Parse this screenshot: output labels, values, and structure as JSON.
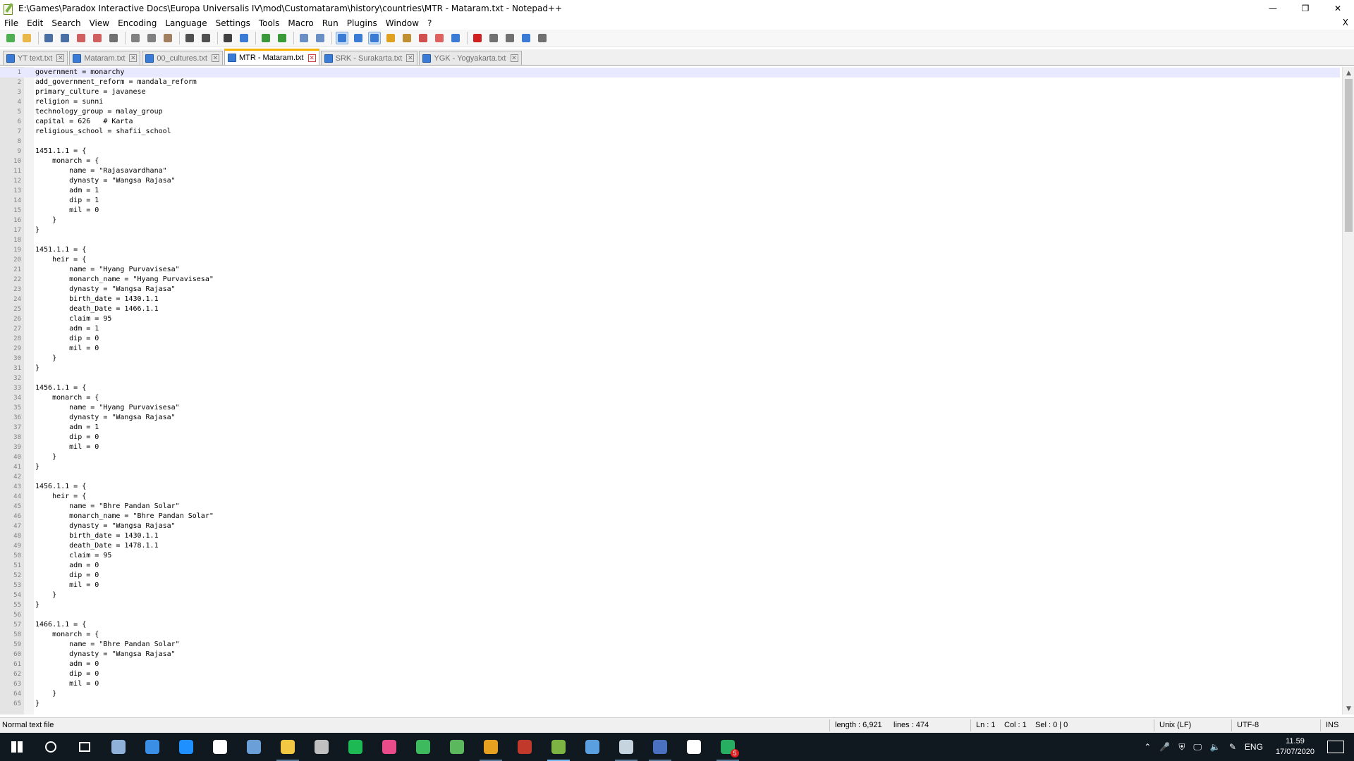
{
  "window": {
    "title": "E:\\Games\\Paradox Interactive Docs\\Europa Universalis IV\\mod\\Customataram\\history\\countries\\MTR - Mataram.txt - Notepad++",
    "controls": [
      "—",
      "❐",
      "✕"
    ]
  },
  "menu": {
    "items": [
      "File",
      "Edit",
      "Search",
      "View",
      "Encoding",
      "Language",
      "Settings",
      "Tools",
      "Macro",
      "Run",
      "Plugins",
      "Window",
      "?"
    ],
    "close_label": "X"
  },
  "toolbar": {
    "buttons": [
      {
        "name": "new-file-icon",
        "color": "#4caf50"
      },
      {
        "name": "open-file-icon",
        "color": "#e8b84a"
      },
      {
        "name": "save-icon",
        "color": "#4a6fa5"
      },
      {
        "name": "save-all-icon",
        "color": "#4a6fa5"
      },
      {
        "name": "close-icon",
        "color": "#d06060"
      },
      {
        "name": "close-all-icon",
        "color": "#d06060"
      },
      {
        "name": "print-icon",
        "color": "#707070"
      },
      {
        "name": "cut-icon",
        "color": "#808080"
      },
      {
        "name": "copy-icon",
        "color": "#808080"
      },
      {
        "name": "paste-icon",
        "color": "#a08060"
      },
      {
        "name": "undo-icon",
        "color": "#505050"
      },
      {
        "name": "redo-icon",
        "color": "#505050"
      },
      {
        "name": "find-icon",
        "color": "#404040"
      },
      {
        "name": "replace-icon",
        "color": "#3a7bd5"
      },
      {
        "name": "zoom-in-icon",
        "color": "#3a9a3a"
      },
      {
        "name": "zoom-out-icon",
        "color": "#3a9a3a"
      },
      {
        "name": "sync-v-scroll-icon",
        "color": "#6a8fc5"
      },
      {
        "name": "sync-h-scroll-icon",
        "color": "#6a8fc5"
      },
      {
        "name": "word-wrap-icon",
        "color": "#3a7bd5"
      },
      {
        "name": "show-all-chars-icon",
        "color": "#3a7bd5"
      },
      {
        "name": "indent-guide-icon",
        "color": "#3a7bd5"
      },
      {
        "name": "doc-map-icon",
        "color": "#e0a020"
      },
      {
        "name": "function-list-icon",
        "color": "#c09030"
      },
      {
        "name": "folder-workspace-icon",
        "color": "#d05050"
      },
      {
        "name": "doc-switcher-icon",
        "color": "#e06060"
      },
      {
        "name": "monitoring-icon",
        "color": "#3a7bd5"
      },
      {
        "name": "record-macro-icon",
        "color": "#d02020"
      },
      {
        "name": "stop-macro-icon",
        "color": "#707070"
      },
      {
        "name": "play-macro-icon",
        "color": "#707070"
      },
      {
        "name": "run-macro-multiple-icon",
        "color": "#3a7bd5"
      },
      {
        "name": "save-macro-icon",
        "color": "#707070"
      }
    ]
  },
  "tabs": [
    {
      "label": "YT text.txt",
      "active": false
    },
    {
      "label": "Mataram.txt",
      "active": false
    },
    {
      "label": "00_cultures.txt",
      "active": false
    },
    {
      "label": "MTR - Mataram.txt",
      "active": true
    },
    {
      "label": "SRK - Surakarta.txt",
      "active": false
    },
    {
      "label": "YGK - Yogyakarta.txt",
      "active": false
    }
  ],
  "editor": {
    "current_line": 1,
    "lines": [
      "government = monarchy",
      "add_government_reform = mandala_reform",
      "primary_culture = javanese",
      "religion = sunni",
      "technology_group = malay_group",
      "capital = 626   # Karta",
      "religious_school = shafii_school",
      "",
      "1451.1.1 = {",
      "    monarch = {",
      "        name = \"Rajasavardhana\"",
      "        dynasty = \"Wangsa Rajasa\"",
      "        adm = 1",
      "        dip = 1",
      "        mil = 0",
      "    }",
      "}",
      "",
      "1451.1.1 = {",
      "    heir = {",
      "        name = \"Hyang Purvavisesa\"",
      "        monarch_name = \"Hyang Purvavisesa\"",
      "        dynasty = \"Wangsa Rajasa\"",
      "        birth_date = 1430.1.1",
      "        death_Date = 1466.1.1",
      "        claim = 95",
      "        adm = 1",
      "        dip = 0",
      "        mil = 0",
      "    }",
      "}",
      "",
      "1456.1.1 = {",
      "    monarch = {",
      "        name = \"Hyang Purvavisesa\"",
      "        dynasty = \"Wangsa Rajasa\"",
      "        adm = 1",
      "        dip = 0",
      "        mil = 0",
      "    }",
      "}",
      "",
      "1456.1.1 = {",
      "    heir = {",
      "        name = \"Bhre Pandan Solar\"",
      "        monarch_name = \"Bhre Pandan Solar\"",
      "        dynasty = \"Wangsa Rajasa\"",
      "        birth_date = 1430.1.1",
      "        death_Date = 1478.1.1",
      "        claim = 95",
      "        adm = 0",
      "        dip = 0",
      "        mil = 0",
      "    }",
      "}",
      "",
      "1466.1.1 = {",
      "    monarch = {",
      "        name = \"Bhre Pandan Solar\"",
      "        dynasty = \"Wangsa Rajasa\"",
      "        adm = 0",
      "        dip = 0",
      "        mil = 0",
      "    }",
      "}"
    ]
  },
  "status": {
    "file_type": "Normal text file",
    "length": "length : 6,921",
    "lines": "lines : 474",
    "ln": "Ln : 1",
    "col": "Col : 1",
    "sel": "Sel : 0 | 0",
    "eol": "Unix (LF)",
    "encoding": "UTF-8",
    "mode": "INS"
  },
  "taskbar": {
    "apps": [
      {
        "name": "start-icon",
        "state": "none"
      },
      {
        "name": "cortana-search-icon",
        "state": "none"
      },
      {
        "name": "task-view-icon",
        "state": "none"
      },
      {
        "name": "photos-icon",
        "state": "none"
      },
      {
        "name": "store-icon",
        "state": "none"
      },
      {
        "name": "mail-icon",
        "state": "none"
      },
      {
        "name": "security-icon",
        "state": "none"
      },
      {
        "name": "calculator-icon",
        "state": "none"
      },
      {
        "name": "file-explorer-icon",
        "state": "open"
      },
      {
        "name": "movie-maker-icon",
        "state": "none"
      },
      {
        "name": "spotify-icon",
        "state": "none"
      },
      {
        "name": "itunes-icon",
        "state": "none"
      },
      {
        "name": "edge-icon",
        "state": "none"
      },
      {
        "name": "utorrent-icon",
        "state": "none"
      },
      {
        "name": "chrome-icon",
        "state": "open"
      },
      {
        "name": "pdf-reader-icon",
        "state": "none"
      },
      {
        "name": "notepadpp-icon",
        "state": "active"
      },
      {
        "name": "notes-icon",
        "state": "none"
      },
      {
        "name": "steam-icon",
        "state": "open"
      },
      {
        "name": "paint-icon",
        "state": "open"
      },
      {
        "name": "game-icon",
        "state": "none"
      },
      {
        "name": "app-badge-icon",
        "state": "open",
        "badge": "5"
      }
    ],
    "language": "ENG",
    "time": "11.59",
    "date": "17/07/2020"
  }
}
